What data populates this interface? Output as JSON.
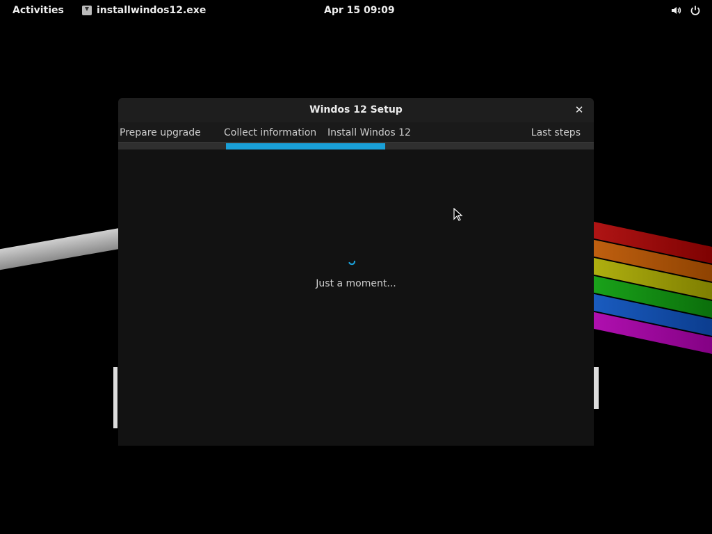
{
  "topbar": {
    "activities": "Activities",
    "app_name": "installwindos12.exe",
    "app_icon": "download-icon",
    "clock": "Apr 15  09:09",
    "tray": [
      "volume-icon",
      "power-icon"
    ]
  },
  "dialog": {
    "title": "Windos 12 Setup",
    "close_icon": "close-icon",
    "steps": [
      "Prepare upgrade",
      "Collect information",
      "Install Windos 12",
      "Last steps"
    ],
    "active_step": "Collect information",
    "status": "Just a moment...",
    "accent_color": "#1aa0d8"
  }
}
